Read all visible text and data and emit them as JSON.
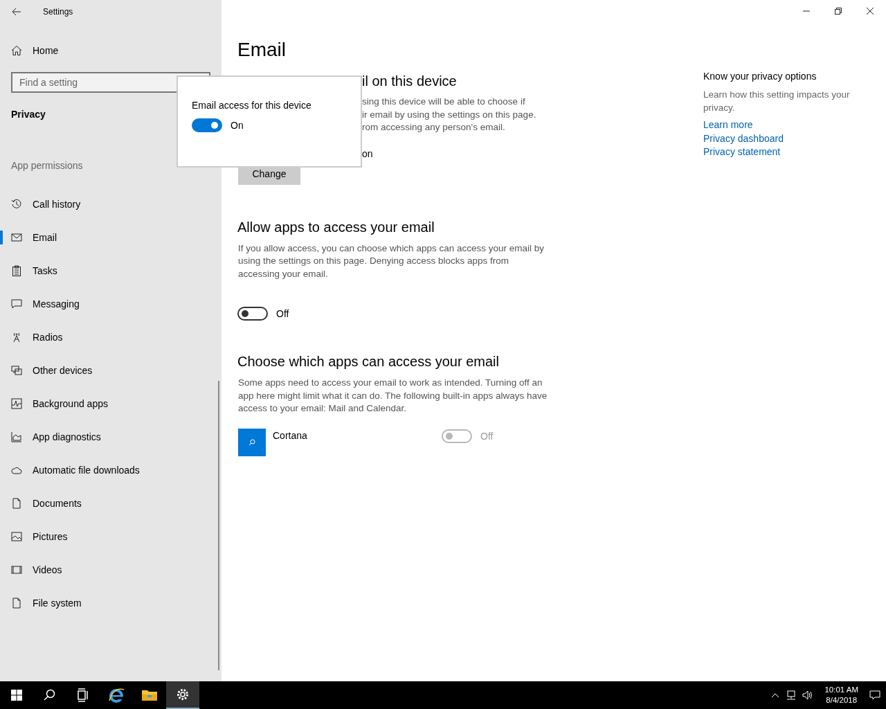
{
  "window": {
    "title": "Settings"
  },
  "sidebar": {
    "home": "Home",
    "search": {
      "placeholder": "Find a setting"
    },
    "category": "Privacy",
    "group": "App permissions",
    "items": [
      {
        "label": "Call history",
        "kind": "history",
        "selected": false
      },
      {
        "label": "Email",
        "kind": "mail",
        "selected": true
      },
      {
        "label": "Tasks",
        "kind": "clipboard",
        "selected": false
      },
      {
        "label": "Messaging",
        "kind": "message",
        "selected": false
      },
      {
        "label": "Radios",
        "kind": "antenna",
        "selected": false
      },
      {
        "label": "Other devices",
        "kind": "devices",
        "selected": false
      },
      {
        "label": "Background apps",
        "kind": "pulse",
        "selected": false
      },
      {
        "label": "App diagnostics",
        "kind": "chart",
        "selected": false
      },
      {
        "label": "Automatic file downloads",
        "kind": "cloud",
        "selected": false
      },
      {
        "label": "Documents",
        "kind": "document",
        "selected": false
      },
      {
        "label": "Pictures",
        "kind": "picture",
        "selected": false
      },
      {
        "label": "Videos",
        "kind": "film",
        "selected": false
      },
      {
        "label": "File system",
        "kind": "document",
        "selected": false
      }
    ]
  },
  "page": {
    "title": "Email",
    "device_section": {
      "heading": "il on this device",
      "lines": [
        "sing this device will be able to choose if",
        "ir email by using the settings on this page.",
        "rom accessing any person's email."
      ],
      "status": "on",
      "button": "Change"
    },
    "popup": {
      "label": "Email access for this device",
      "toggle": {
        "on": true,
        "state_text": "On"
      }
    },
    "allow_section": {
      "heading": "Allow apps to access your email",
      "description": "If you allow access, you can choose which apps can access your email by using the settings on this page. Denying access blocks apps from accessing your email.",
      "toggle": {
        "on": false,
        "state_text": "Off"
      }
    },
    "apps_section": {
      "heading": "Choose which apps can access your email",
      "description": "Some apps need to access your email to work as intended. Turning off an app here might limit what it can do. The following built-in apps always have access to your email: Mail and Calendar.",
      "apps": [
        {
          "name": "Cortana",
          "on": false,
          "disabled": true,
          "state_text": "Off"
        }
      ]
    }
  },
  "aside": {
    "heading": "Know your privacy options",
    "description": "Learn how this setting impacts your privacy.",
    "links": [
      "Learn more",
      "Privacy dashboard",
      "Privacy statement"
    ]
  },
  "taskbar": {
    "apps": [
      {
        "kind": "start",
        "selected": false
      },
      {
        "kind": "search",
        "selected": false
      },
      {
        "kind": "taskview",
        "selected": false
      },
      {
        "kind": "browser",
        "selected": false
      },
      {
        "kind": "folder",
        "selected": false
      },
      {
        "kind": "settings",
        "selected": true
      }
    ],
    "time": "10:01 AM",
    "date": "8/4/2018"
  }
}
